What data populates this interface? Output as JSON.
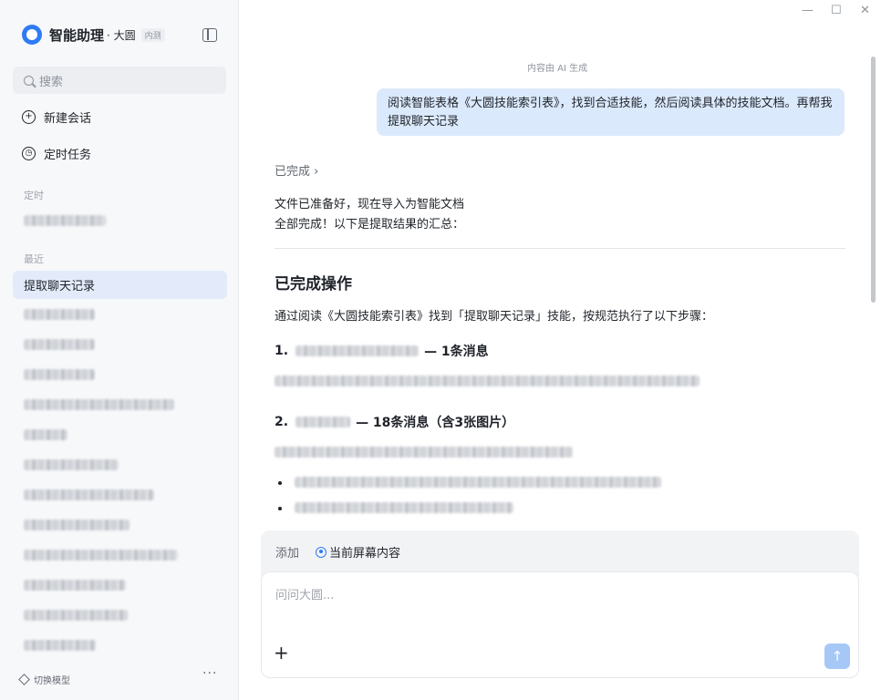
{
  "app": {
    "title": "智能助理",
    "separator": "· 大圆",
    "tag": "内测"
  },
  "window": {
    "minimize": "—",
    "maximize": "☐",
    "close": "✕"
  },
  "sidebar": {
    "search_placeholder": "搜索",
    "new_chat": "新建会话",
    "scheduled_tasks": "定时任务",
    "section_scheduled": "定时",
    "section_recent": "最近",
    "active_item": "提取聊天记录",
    "model_switch": "切换模型",
    "more": "···"
  },
  "conversation": {
    "ai_notice": "内容由 AI 生成",
    "user_message": "阅读智能表格《大圆技能索引表》，找到合适技能，然后阅读具体的技能文档。再帮我提取聊天记录",
    "status": "已完成 ›",
    "reply_line1": "文件已准备好，现在导入为智能文档",
    "reply_line2": "全部完成！以下是提取结果的汇总：",
    "heading": "已完成操作",
    "intro": "通过阅读《大圆技能索引表》找到「提取聊天记录」技能，按规范执行了以下步骤：",
    "step1_num": "1.",
    "step1_suffix": "— 1条消息",
    "step2_num": "2.",
    "step2_suffix": "— 18条消息（含3张图片）"
  },
  "composer": {
    "add_label": "添加",
    "screen_chip": "当前屏幕内容",
    "placeholder": "问问大圆...",
    "plus": "+",
    "send": "↑"
  }
}
